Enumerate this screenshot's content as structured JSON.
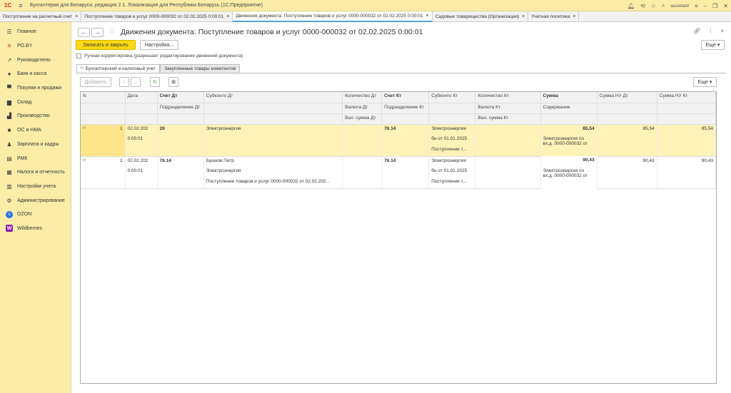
{
  "titlebar": {
    "app_title": "Бухгалтерия для Беларуси, редакция 2.1. Локализация для Республики Беларусь  (1С:Предприятие)",
    "logo": "1С",
    "user": "assistant"
  },
  "tabs": [
    {
      "label": "Поступление на расчетный счет"
    },
    {
      "label": "Поступление товаров и услуг 0000-000032 от 02.02.2025 0:00:01"
    },
    {
      "label": "Движения документа: Поступление товаров и услуг 0000-000032 от 02.02.2025 0:00:01"
    },
    {
      "label": "Садовые товарищества (Организация)"
    },
    {
      "label": "Учетная политика"
    }
  ],
  "sidebar": {
    "items": [
      {
        "label": "Главное",
        "icon": "menu-icon"
      },
      {
        "label": "РО.BY",
        "icon": "snowflake-icon"
      },
      {
        "label": "Руководителю",
        "icon": "trend-icon"
      },
      {
        "label": "Банк и касса",
        "icon": "coin-icon"
      },
      {
        "label": "Покупки и продажи",
        "icon": "cart-icon"
      },
      {
        "label": "Склад",
        "icon": "warehouse-icon"
      },
      {
        "label": "Производство",
        "icon": "factory-icon"
      },
      {
        "label": "ОС и НМА",
        "icon": "truck-icon"
      },
      {
        "label": "Зарплата и кадры",
        "icon": "people-icon"
      },
      {
        "label": "РМК",
        "icon": "register-icon"
      },
      {
        "label": "Налоги и отчетность",
        "icon": "tax-icon"
      },
      {
        "label": "Настройки учета",
        "icon": "ledger-icon"
      },
      {
        "label": "Администрирование",
        "icon": "gear-icon"
      },
      {
        "label": "OZON",
        "icon": "ozon-icon"
      },
      {
        "label": "Wildberries",
        "icon": "wildberries-icon"
      }
    ]
  },
  "header": {
    "title": "Движения документа: Поступление товаров и услуг 0000-000032 от 02.02.2025 0:00:01"
  },
  "toolbar": {
    "save_close": "Записать и закрыть",
    "settings": "Настройка...",
    "more": "Еще",
    "manual_correction": "Ручная корректировка (разрешает редактирование движений документа)"
  },
  "subtabs": [
    {
      "label": "Бухгалтерский и налоговый учет"
    },
    {
      "label": "Закупленные товары комитентов"
    }
  ],
  "grid_toolbar": {
    "add": "Добавить",
    "more": "Еще"
  },
  "columns": {
    "n": "N",
    "date": "Дата",
    "acc_dt": "Счет Дт",
    "sub_dt": "Субконто Дт",
    "qty_dt": "Количество Дт",
    "acc_kt": "Счет Кт",
    "sub_kt": "Субконто Кт",
    "qty_kt": "Количество Кт",
    "sum": "Сумма",
    "nu_dt": "Сумма НУ Дт",
    "nu_kt": "Сумма НУ Кт",
    "dept_dt": "Подразделение Дт",
    "cur_dt": "Валюта Дт",
    "cursum_dt": "Вал. сумма Дт",
    "dept_kt": "Подразделение Кт",
    "cur_kt": "Валюта Кт",
    "cursum_kt": "Вал. сумма Кт",
    "content": "Содержание"
  },
  "rows": [
    {
      "n": "1",
      "date": "02.02.202",
      "time": "0:00:01",
      "acc_dt": "26",
      "sub_dt": [
        "Электроэнергия",
        "",
        ""
      ],
      "acc_kt": "76.14",
      "sub_kt": [
        "Электроэнергия",
        "бн от 01.01.2025",
        "Поступление т..."
      ],
      "sum": "85,54",
      "content": "Электроэнергия  по вх.д. 0000-000032 от",
      "nu_dt": "85,54",
      "nu_kt": "85,54"
    },
    {
      "n": "2",
      "date": "02.02.202",
      "time": "0:00:01",
      "acc_dt": "76.14",
      "sub_dt": [
        "Бушков Петр",
        "Электроэнергия",
        "Поступление товаров и услуг 0000-000032 от 02.02.202..."
      ],
      "acc_kt": "76.14",
      "sub_kt": [
        "Электроэнергия",
        "бн от 01.01.2025",
        "Поступление т..."
      ],
      "sum": "90,43",
      "content": "Электроэнергия  по вх.д. 0000-000032 от",
      "nu_dt": "90,43",
      "nu_kt": "90,43"
    }
  ]
}
